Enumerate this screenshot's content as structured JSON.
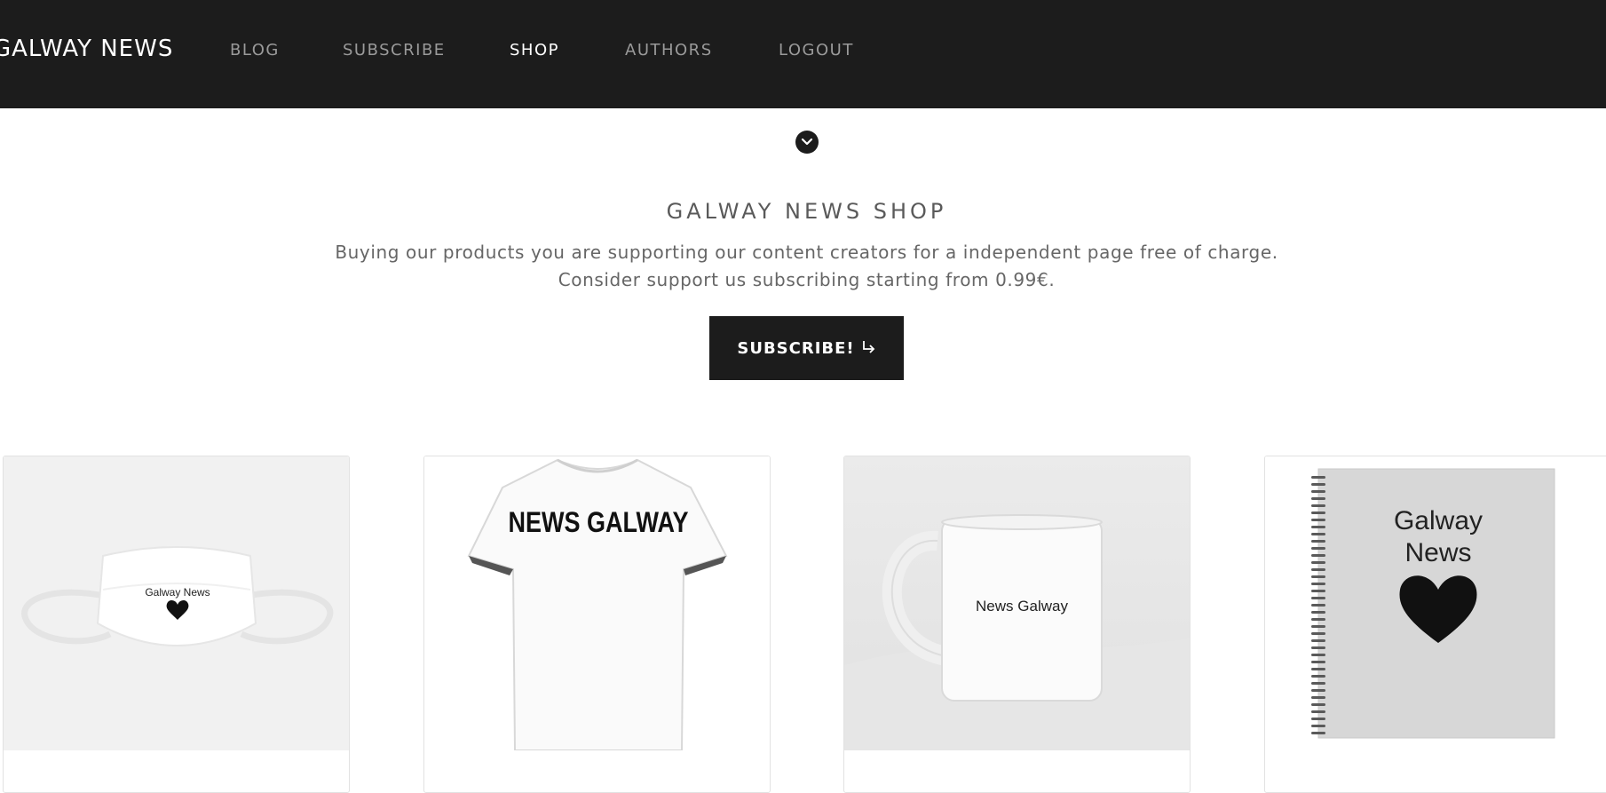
{
  "navbar": {
    "brand": "GALWAY NEWS",
    "items": [
      {
        "label": "BLOG",
        "active": false
      },
      {
        "label": "SUBSCRIBE",
        "active": false
      },
      {
        "label": "SHOP",
        "active": true
      },
      {
        "label": "AUTHORS",
        "active": false
      },
      {
        "label": "LOGOUT",
        "active": false
      }
    ]
  },
  "scroll_icon": "chevron-down-icon",
  "shop": {
    "title": "GALWAY NEWS SHOP",
    "intro_line1": "Buying our products you are supporting our content creators for a independent page free of charge.",
    "intro_line2": "Consider support us subscribing starting from 0.99€.",
    "subscribe_label": "SUBSCRIBE!",
    "subscribe_icon": "return-arrow-icon"
  },
  "products": [
    {
      "name": "face-mask",
      "print_text": "Galway News"
    },
    {
      "name": "t-shirt",
      "print_text": "NEWS GALWAY"
    },
    {
      "name": "mug",
      "print_text": "News Galway"
    },
    {
      "name": "notebook",
      "print_line1": "Galway",
      "print_line2": "News"
    }
  ],
  "colors": {
    "nav_bg": "#1c1c1c",
    "nav_text": "#9a9a9a",
    "nav_active": "#ffffff",
    "button_bg": "#1c1c1c"
  }
}
